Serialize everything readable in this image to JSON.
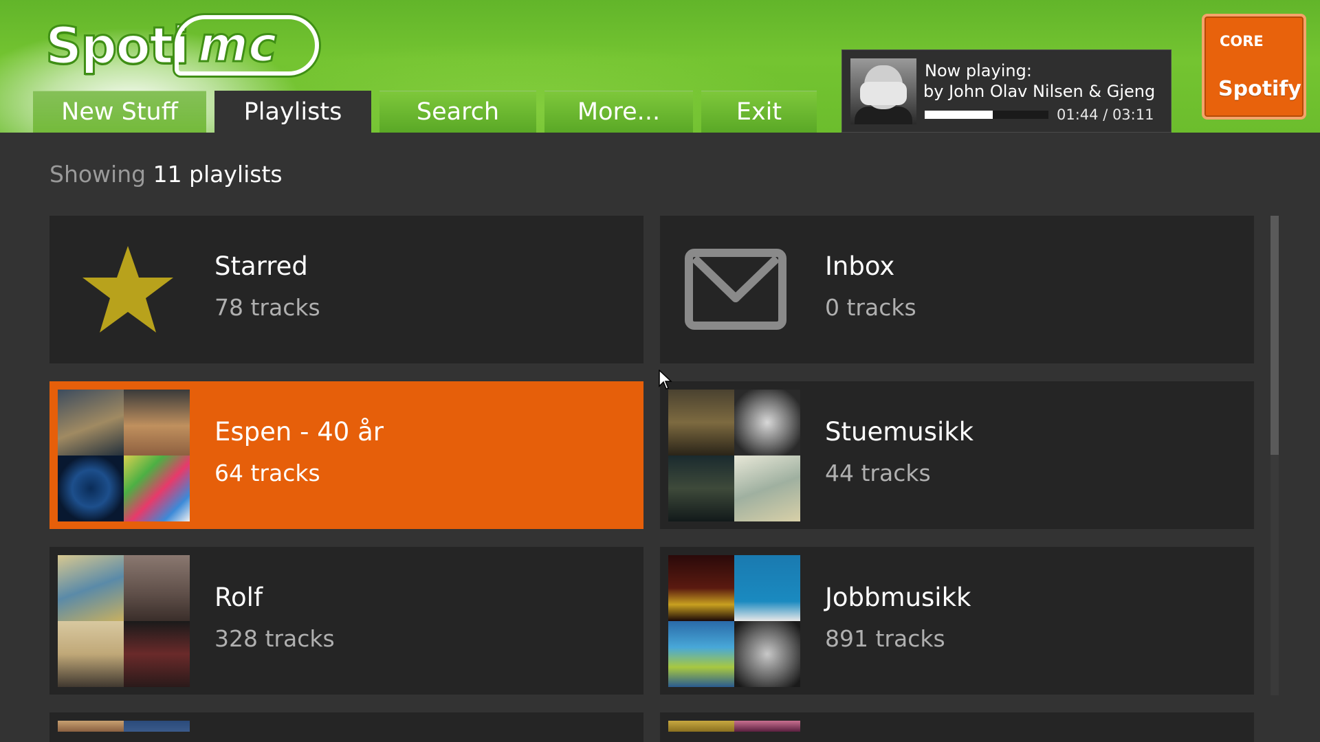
{
  "app": {
    "logo_text": "Spoti",
    "logo_suffix": "mc"
  },
  "tabs": [
    {
      "label": "New Stuff",
      "active": false
    },
    {
      "label": "Playlists",
      "active": true
    },
    {
      "label": "Search",
      "active": false
    },
    {
      "label": "More...",
      "active": false
    },
    {
      "label": "Exit",
      "active": false
    }
  ],
  "now_playing": {
    "label": "Now playing:",
    "artist_line": "by John Olav Nilsen & Gjeng",
    "progress": 0.55,
    "time": "01:44 / 03:11"
  },
  "badge": {
    "core": "CORE",
    "brand": "Spotify"
  },
  "content": {
    "showing_prefix": "Showing",
    "showing_count": "11 playlists"
  },
  "playlists": [
    {
      "title": "Starred",
      "tracks": "78 tracks",
      "icon": "star-icon",
      "selected": false
    },
    {
      "title": "Inbox",
      "tracks": "0 tracks",
      "icon": "mail-icon",
      "selected": false
    },
    {
      "title": "Espen - 40 år",
      "tracks": "64 tracks",
      "icon": "album-grid",
      "selected": true
    },
    {
      "title": "Stuemusikk",
      "tracks": "44 tracks",
      "icon": "album-grid",
      "selected": false
    },
    {
      "title": "Rolf",
      "tracks": "328 tracks",
      "icon": "album-grid",
      "selected": false
    },
    {
      "title": "Jobbmusikk",
      "tracks": "891 tracks",
      "icon": "album-grid",
      "selected": false
    }
  ],
  "colors": {
    "header_green": "#6cbd2d",
    "selected_orange": "#e65f0a",
    "card_bg": "#252525",
    "page_bg": "#333333",
    "star_yellow": "#b8a21c",
    "mail_gray": "#8a8a8a"
  }
}
